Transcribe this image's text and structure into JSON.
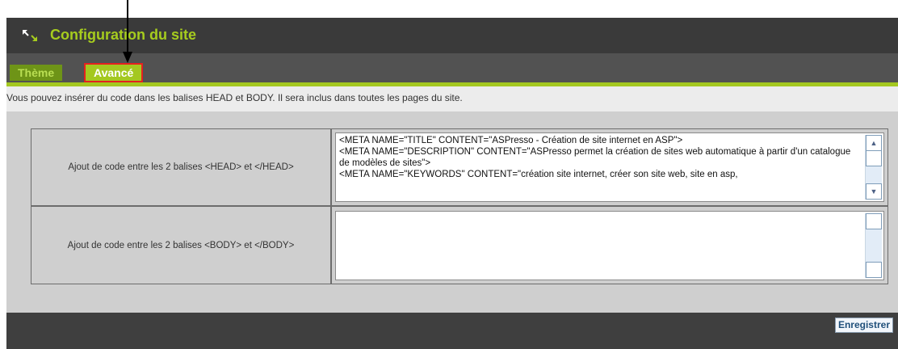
{
  "header": {
    "title": "Configuration du site",
    "icon": "resize-arrows-icon"
  },
  "tabs": [
    {
      "label": "Thème",
      "active": false
    },
    {
      "label": "Avancé",
      "active": true
    }
  ],
  "info": {
    "text": "Vous pouvez insérer du code dans les balises HEAD et BODY. Il sera inclus dans toutes les pages du site."
  },
  "fields": {
    "head": {
      "label": "Ajout de code entre les 2 balises <HEAD> et </HEAD>",
      "value": "<META NAME=\"TITLE\" CONTENT=\"ASPresso - Création de site internet en ASP\">\n<META NAME=\"DESCRIPTION\" CONTENT=\"ASPresso permet la création de sites web automatique à partir d'un catalogue de modèles de sites\">\n<META NAME=\"KEYWORDS\" CONTENT=\"création site internet, créer son site web, site en asp,"
    },
    "body": {
      "label": "Ajout de code entre les 2 balises <BODY> et </BODY>",
      "value": ""
    }
  },
  "actions": {
    "save_label": "Enregistrer"
  },
  "colors": {
    "accent_green": "#a4c820",
    "tab_inactive": "#6e9417",
    "highlight_red": "#e52020",
    "title_green": "#a6cc1e"
  }
}
